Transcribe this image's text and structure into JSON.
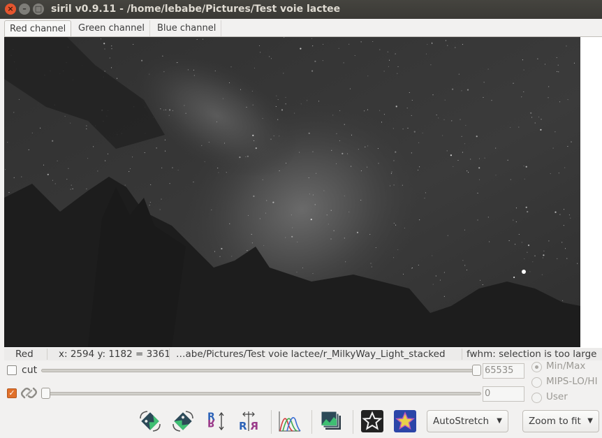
{
  "window": {
    "title": "siril v0.9.11 - /home/lebabe/Pictures/Test voie lactee",
    "close_glyph": "×",
    "minimize_glyph": "–",
    "maximize_glyph": "□"
  },
  "tabs": [
    {
      "label": "Red channel",
      "active": true
    },
    {
      "label": "Green channel",
      "active": false
    },
    {
      "label": "Blue channel",
      "active": false
    }
  ],
  "statusbar": {
    "channel": "Red",
    "coords": "x: 2594 y: 1182 = 3361",
    "filename": "…abe/Pictures/Test voie lactee/r_MilkyWay_Light_stacked",
    "fwhm": "fwhm: selection is too large"
  },
  "levels": {
    "cut_label": "cut",
    "cut_checked": false,
    "high_value": "65535",
    "low_value": "0",
    "link_checked": true,
    "high_fraction": 1.0,
    "low_fraction": 0.0
  },
  "scale_modes": [
    {
      "label": "Min/Max",
      "selected": true
    },
    {
      "label": "MIPS-LO/HI",
      "selected": false
    },
    {
      "label": "User",
      "selected": false
    }
  ],
  "toolbar": {
    "icons": [
      "rotate-left-icon",
      "rotate-right-icon",
      "mirror-vertical-icon",
      "mirror-horizontal-icon",
      "histogram-icon",
      "image-stack-icon",
      "star-outline-icon",
      "star-color-icon"
    ],
    "stretch_label": "AutoStretch",
    "zoom_label": "Zoom to fit",
    "dropdown_arrow": "▼"
  },
  "colors": {
    "accent": "#e0702a",
    "titlebar": "#3c3b37",
    "close_button": "#e5552e"
  }
}
